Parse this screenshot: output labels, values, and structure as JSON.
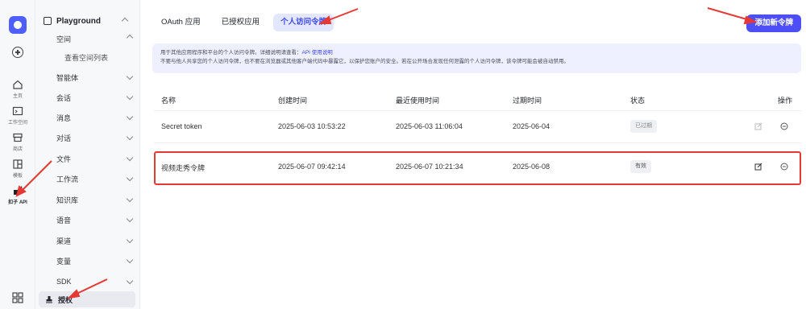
{
  "rail": {
    "items": [
      {
        "label": "主页"
      },
      {
        "label": "工作空间"
      },
      {
        "label": "商店"
      },
      {
        "label": "模板"
      },
      {
        "label": "扣子 API"
      }
    ]
  },
  "sidebar": {
    "header": "Playground",
    "items": [
      {
        "label": "空间"
      },
      {
        "label": "查看空间列表"
      },
      {
        "label": "智能体"
      },
      {
        "label": "会话"
      },
      {
        "label": "消息"
      },
      {
        "label": "对话"
      },
      {
        "label": "文件"
      },
      {
        "label": "工作流"
      },
      {
        "label": "知识库"
      },
      {
        "label": "语音"
      },
      {
        "label": "渠道"
      },
      {
        "label": "变量"
      },
      {
        "label": "SDK"
      },
      {
        "label": "授权"
      }
    ]
  },
  "tabs": [
    {
      "label": "OAuth 应用"
    },
    {
      "label": "已授权应用"
    },
    {
      "label": "个人访问令牌"
    }
  ],
  "add_button": "添加新令牌",
  "notice": {
    "line1": "用于其他应用程序和平台的个人访问令牌。详细说明请查看：",
    "link": "API 使用说明",
    "line2": "不要与他人共享您的个人访问令牌，也不要在浏览器或其他客户端代码中暴露它，以保护您账户的安全。若在公开场合发现任何泄露的个人访问令牌，该令牌可能会被自动禁用。"
  },
  "table": {
    "headers": [
      "名称",
      "创建时间",
      "最近使用时间",
      "过期时间",
      "状态",
      "操作"
    ],
    "rows": [
      {
        "name": "Secret token",
        "created": "2025-06-03 10:53:22",
        "last_used": "2025-06-03 11:06:04",
        "expires": "2025-06-04",
        "status": "已过期"
      },
      {
        "name": "视频走秀令牌",
        "created": "2025-06-07 09:42:14",
        "last_used": "2025-06-07 10:21:34",
        "expires": "2025-06-08",
        "status": "有效"
      }
    ]
  },
  "colors": {
    "accent": "#4e4ef7",
    "tab_active_bg": "#e3e6ff",
    "annotation": "#e53935"
  }
}
